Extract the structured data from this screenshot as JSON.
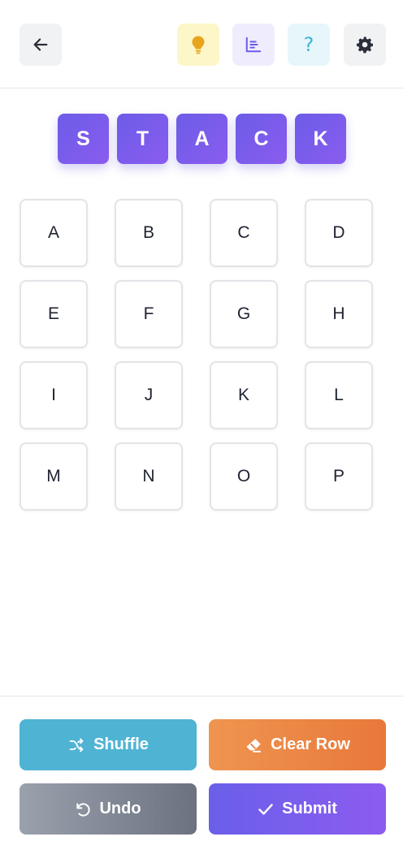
{
  "header": {
    "icons": [
      "arrow-left-icon",
      "lightbulb-icon",
      "bar-chart-icon",
      "question-icon",
      "gear-icon"
    ],
    "help_glyph": "?"
  },
  "word": [
    "S",
    "T",
    "A",
    "C",
    "K"
  ],
  "grid": [
    "A",
    "B",
    "C",
    "D",
    "E",
    "F",
    "G",
    "H",
    "I",
    "J",
    "K",
    "L",
    "M",
    "N",
    "O",
    "P"
  ],
  "actions": {
    "shuffle_label": "Shuffle",
    "clear_label": "Clear Row",
    "undo_label": "Undo",
    "submit_label": "Submit"
  },
  "colors": {
    "accent": "#6c5ce7",
    "shuffle": "#4fb3d3",
    "clear": "#e8783a",
    "undo": "#6c7280",
    "hint": "#f0b020"
  }
}
